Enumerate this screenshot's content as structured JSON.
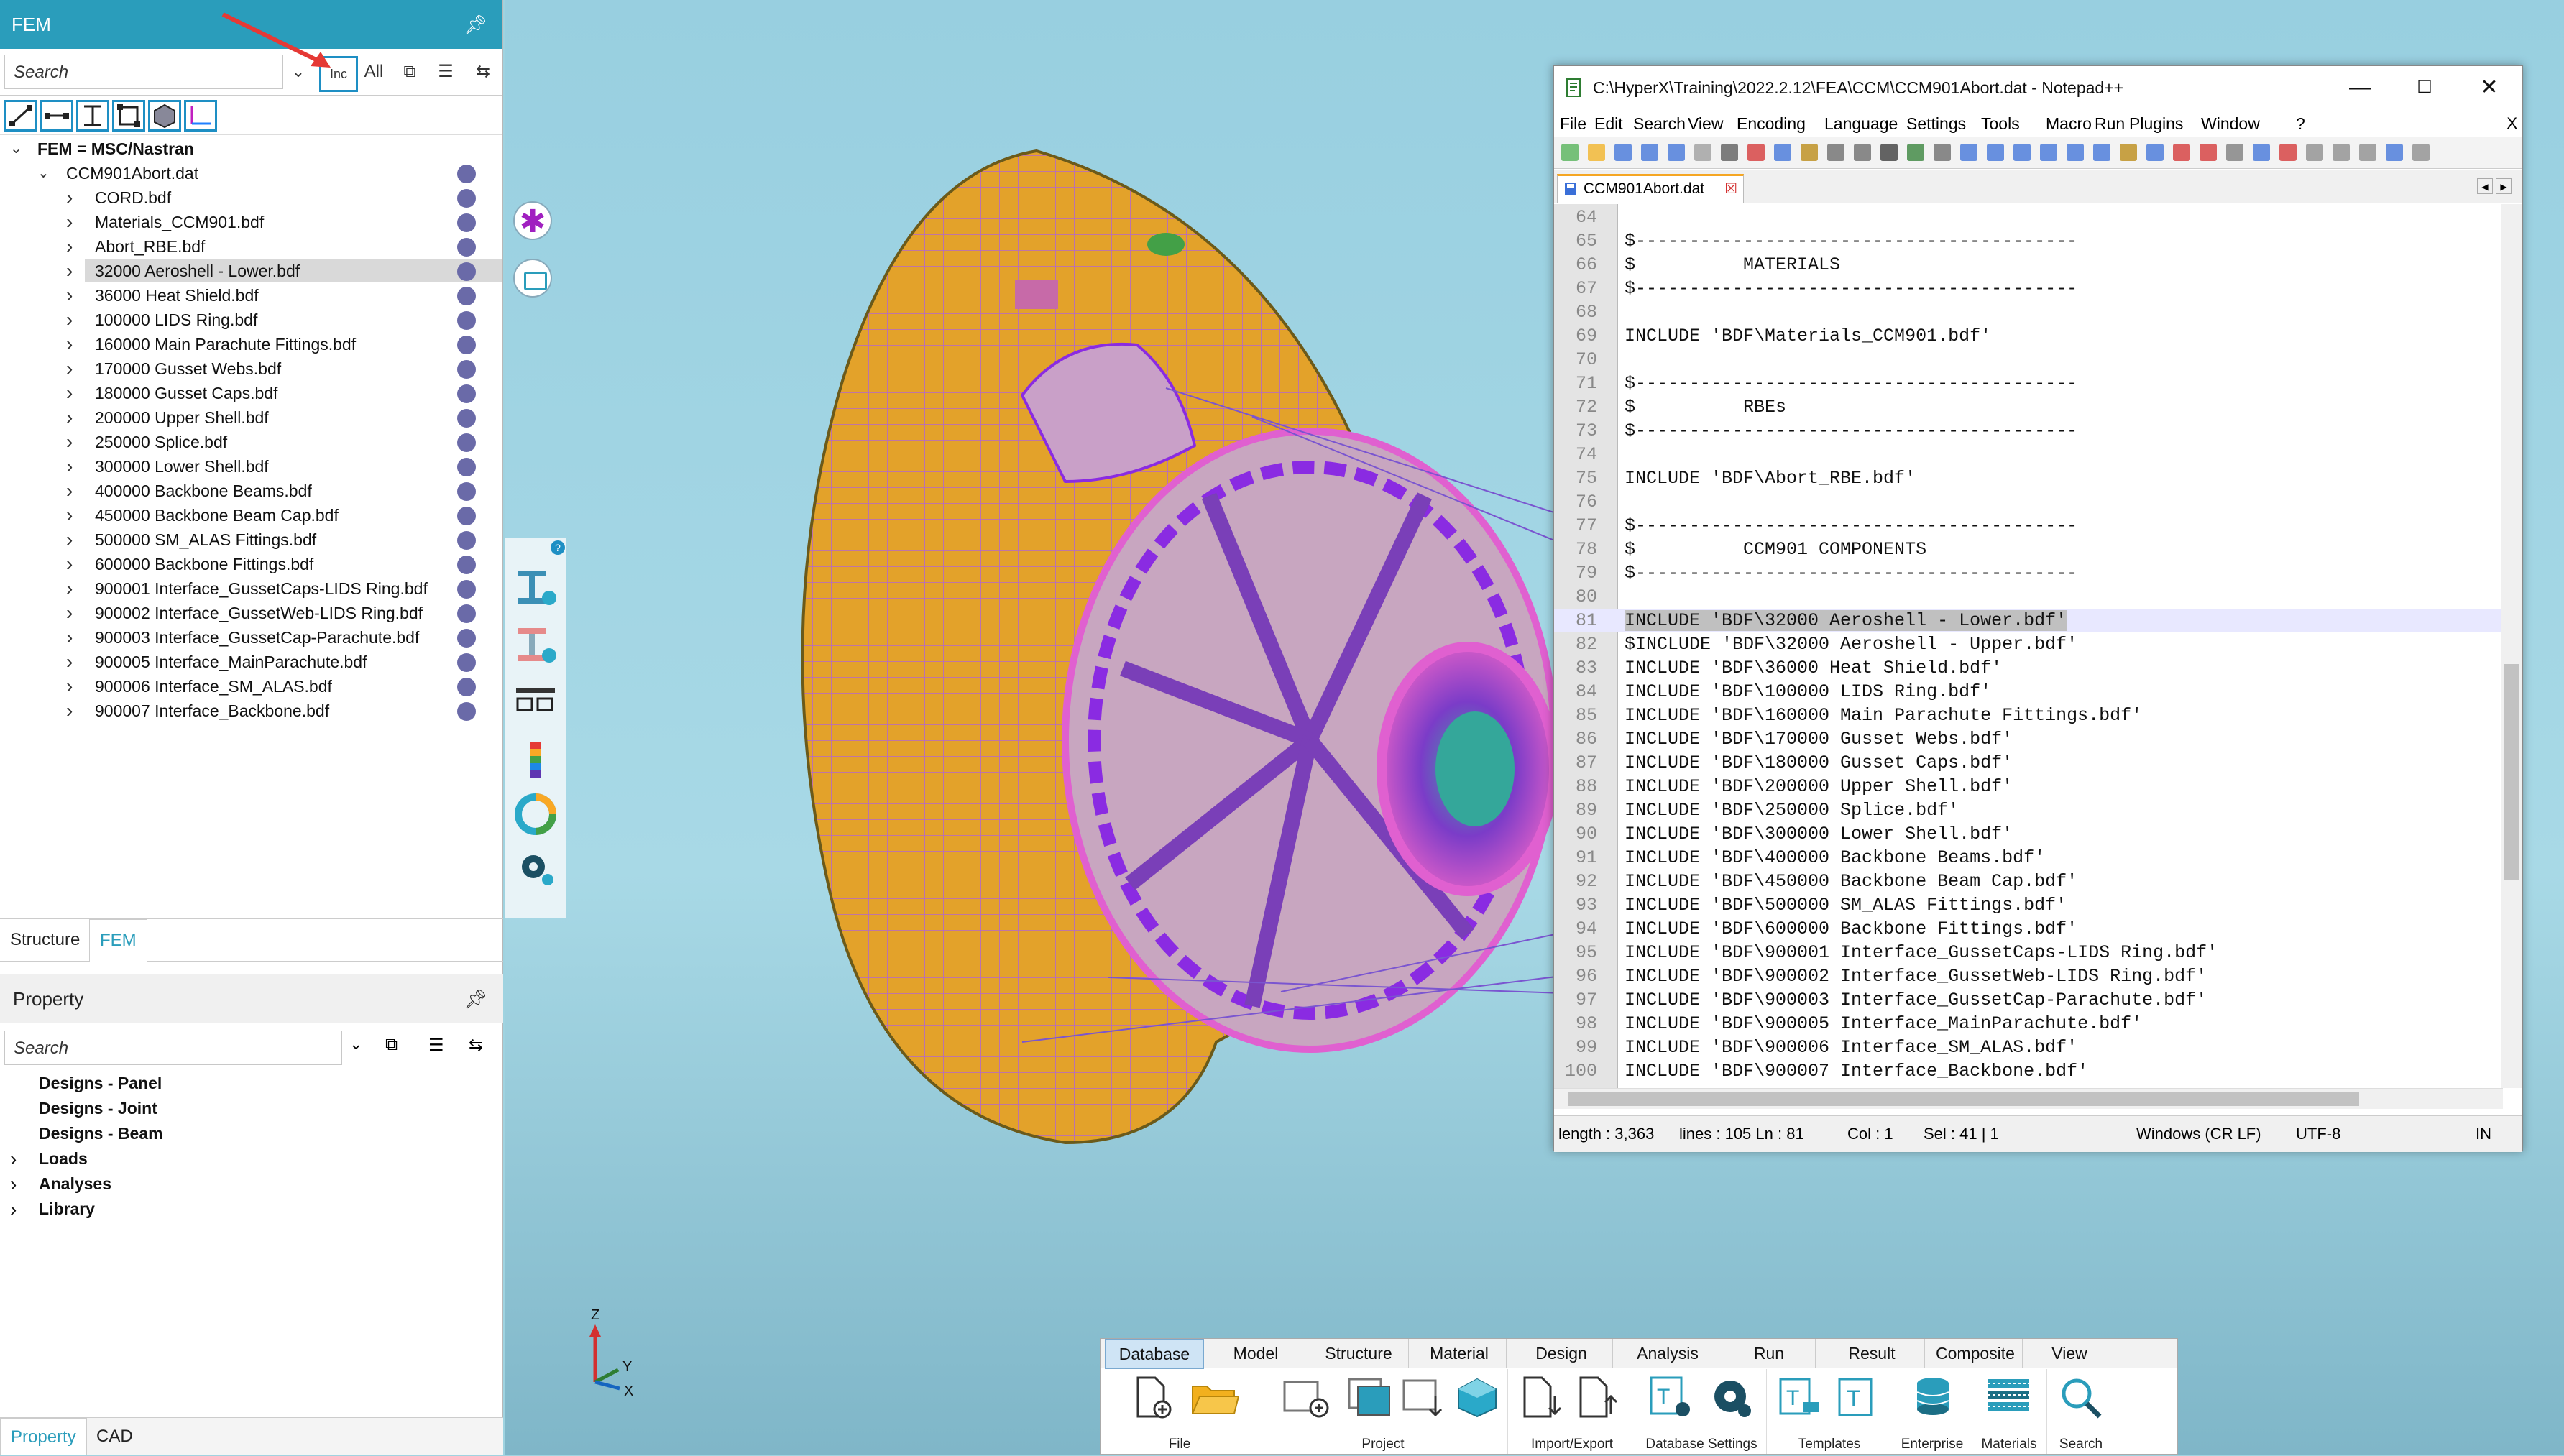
{
  "left_panel": {
    "title": "FEM",
    "search_placeholder": "Search",
    "inc_label": "Inc",
    "all_label": "All",
    "tree_root": "FEM = MSC/Nastran",
    "tree_file": "CCM901Abort.dat",
    "tree_items": [
      "CORD.bdf",
      "Materials_CCM901.bdf",
      "Abort_RBE.bdf",
      "32000 Aeroshell - Lower.bdf",
      "36000 Heat Shield.bdf",
      "100000 LIDS Ring.bdf",
      "160000 Main Parachute Fittings.bdf",
      "170000 Gusset Webs.bdf",
      "180000 Gusset Caps.bdf",
      "200000 Upper Shell.bdf",
      "250000 Splice.bdf",
      "300000 Lower Shell.bdf",
      "400000 Backbone Beams.bdf",
      "450000 Backbone Beam Cap.bdf",
      "500000 SM_ALAS Fittings.bdf",
      "600000 Backbone Fittings.bdf",
      "900001 Interface_GussetCaps-LIDS Ring.bdf",
      "900002 Interface_GussetWeb-LIDS Ring.bdf",
      "900003 Interface_GussetCap-Parachute.bdf",
      "900005 Interface_MainParachute.bdf",
      "900006 Interface_SM_ALAS.bdf",
      "900007 Interface_Backbone.bdf"
    ],
    "selected_index": 3,
    "tabs": [
      "Structure",
      "FEM"
    ],
    "property_title": "Property",
    "property_search_placeholder": "Search",
    "property_items": [
      {
        "label": "Designs - Panel",
        "expandable": false
      },
      {
        "label": "Designs - Joint",
        "expandable": false
      },
      {
        "label": "Designs - Beam",
        "expandable": false
      },
      {
        "label": "Loads",
        "expandable": true
      },
      {
        "label": "Analyses",
        "expandable": true
      },
      {
        "label": "Library",
        "expandable": true
      }
    ],
    "bottom_tabs": [
      "Property",
      "CAD"
    ]
  },
  "viewport": {
    "axis_labels": {
      "z": "Z",
      "y": "Y",
      "x": "X"
    },
    "colors": {
      "aeroshell": "#e3a22a",
      "mesh_line": "#b366cc",
      "heat_shield": "#8a2be2"
    }
  },
  "notepad": {
    "title": "C:\\HyperX\\Training\\2022.2.12\\FEA\\CCM\\CCM901Abort.dat - Notepad++",
    "menu": [
      "File",
      "Edit",
      "Search",
      "View",
      "Encoding",
      "Language",
      "Settings",
      "Tools",
      "Macro",
      "Run",
      "Plugins",
      "Window",
      "?"
    ],
    "close_x": "X",
    "tab_label": "CCM901Abort.dat",
    "current_line": 81,
    "lines": [
      {
        "n": "64",
        "t": ""
      },
      {
        "n": "65",
        "t": "$-----------------------------------------"
      },
      {
        "n": "66",
        "t": "$          MATERIALS"
      },
      {
        "n": "67",
        "t": "$-----------------------------------------"
      },
      {
        "n": "68",
        "t": ""
      },
      {
        "n": "69",
        "t": "INCLUDE 'BDF\\Materials_CCM901.bdf'"
      },
      {
        "n": "70",
        "t": ""
      },
      {
        "n": "71",
        "t": "$-----------------------------------------"
      },
      {
        "n": "72",
        "t": "$          RBEs"
      },
      {
        "n": "73",
        "t": "$-----------------------------------------"
      },
      {
        "n": "74",
        "t": ""
      },
      {
        "n": "75",
        "t": "INCLUDE 'BDF\\Abort_RBE.bdf'"
      },
      {
        "n": "76",
        "t": ""
      },
      {
        "n": "77",
        "t": "$-----------------------------------------"
      },
      {
        "n": "78",
        "t": "$          CCM901 COMPONENTS"
      },
      {
        "n": "79",
        "t": "$-----------------------------------------"
      },
      {
        "n": "80",
        "t": ""
      },
      {
        "n": "81",
        "t": "INCLUDE 'BDF\\32000 Aeroshell - Lower.bdf'"
      },
      {
        "n": "82",
        "t": "$INCLUDE 'BDF\\32000 Aeroshell - Upper.bdf'"
      },
      {
        "n": "83",
        "t": "INCLUDE 'BDF\\36000 Heat Shield.bdf'"
      },
      {
        "n": "84",
        "t": "INCLUDE 'BDF\\100000 LIDS Ring.bdf'"
      },
      {
        "n": "85",
        "t": "INCLUDE 'BDF\\160000 Main Parachute Fittings.bdf'"
      },
      {
        "n": "86",
        "t": "INCLUDE 'BDF\\170000 Gusset Webs.bdf'"
      },
      {
        "n": "87",
        "t": "INCLUDE 'BDF\\180000 Gusset Caps.bdf'"
      },
      {
        "n": "88",
        "t": "INCLUDE 'BDF\\200000 Upper Shell.bdf'"
      },
      {
        "n": "89",
        "t": "INCLUDE 'BDF\\250000 Splice.bdf'"
      },
      {
        "n": "90",
        "t": "INCLUDE 'BDF\\300000 Lower Shell.bdf'"
      },
      {
        "n": "91",
        "t": "INCLUDE 'BDF\\400000 Backbone Beams.bdf'"
      },
      {
        "n": "92",
        "t": "INCLUDE 'BDF\\450000 Backbone Beam Cap.bdf'"
      },
      {
        "n": "93",
        "t": "INCLUDE 'BDF\\500000 SM_ALAS Fittings.bdf'"
      },
      {
        "n": "94",
        "t": "INCLUDE 'BDF\\600000 Backbone Fittings.bdf'"
      },
      {
        "n": "95",
        "t": "INCLUDE 'BDF\\900001 Interface_GussetCaps-LIDS Ring.bdf'"
      },
      {
        "n": "96",
        "t": "INCLUDE 'BDF\\900002 Interface_GussetWeb-LIDS Ring.bdf'"
      },
      {
        "n": "97",
        "t": "INCLUDE 'BDF\\900003 Interface_GussetCap-Parachute.bdf'"
      },
      {
        "n": "98",
        "t": "INCLUDE 'BDF\\900005 Interface_MainParachute.bdf'"
      },
      {
        "n": "99",
        "t": "INCLUDE 'BDF\\900006 Interface_SM_ALAS.bdf'"
      },
      {
        "n": "100",
        "t": "INCLUDE 'BDF\\900007 Interface_Backbone.bdf'"
      }
    ],
    "status": {
      "length": "length : 3,363",
      "lines": "lines : 105  Ln : 81",
      "col": "Col : 1",
      "sel": "Sel : 41 | 1",
      "eol": "Windows (CR LF)",
      "enc": "UTF-8",
      "mode": "IN"
    }
  },
  "ribbon": {
    "tabs": [
      "Database",
      "Model",
      "Structure",
      "Material",
      "Design",
      "Analysis",
      "Run",
      "Result",
      "Composite",
      "View"
    ],
    "active_tab": "Database",
    "groups": [
      "File",
      "Project",
      "Import/Export",
      "Database Settings",
      "Templates",
      "Enterprise",
      "Materials",
      "Search"
    ]
  }
}
